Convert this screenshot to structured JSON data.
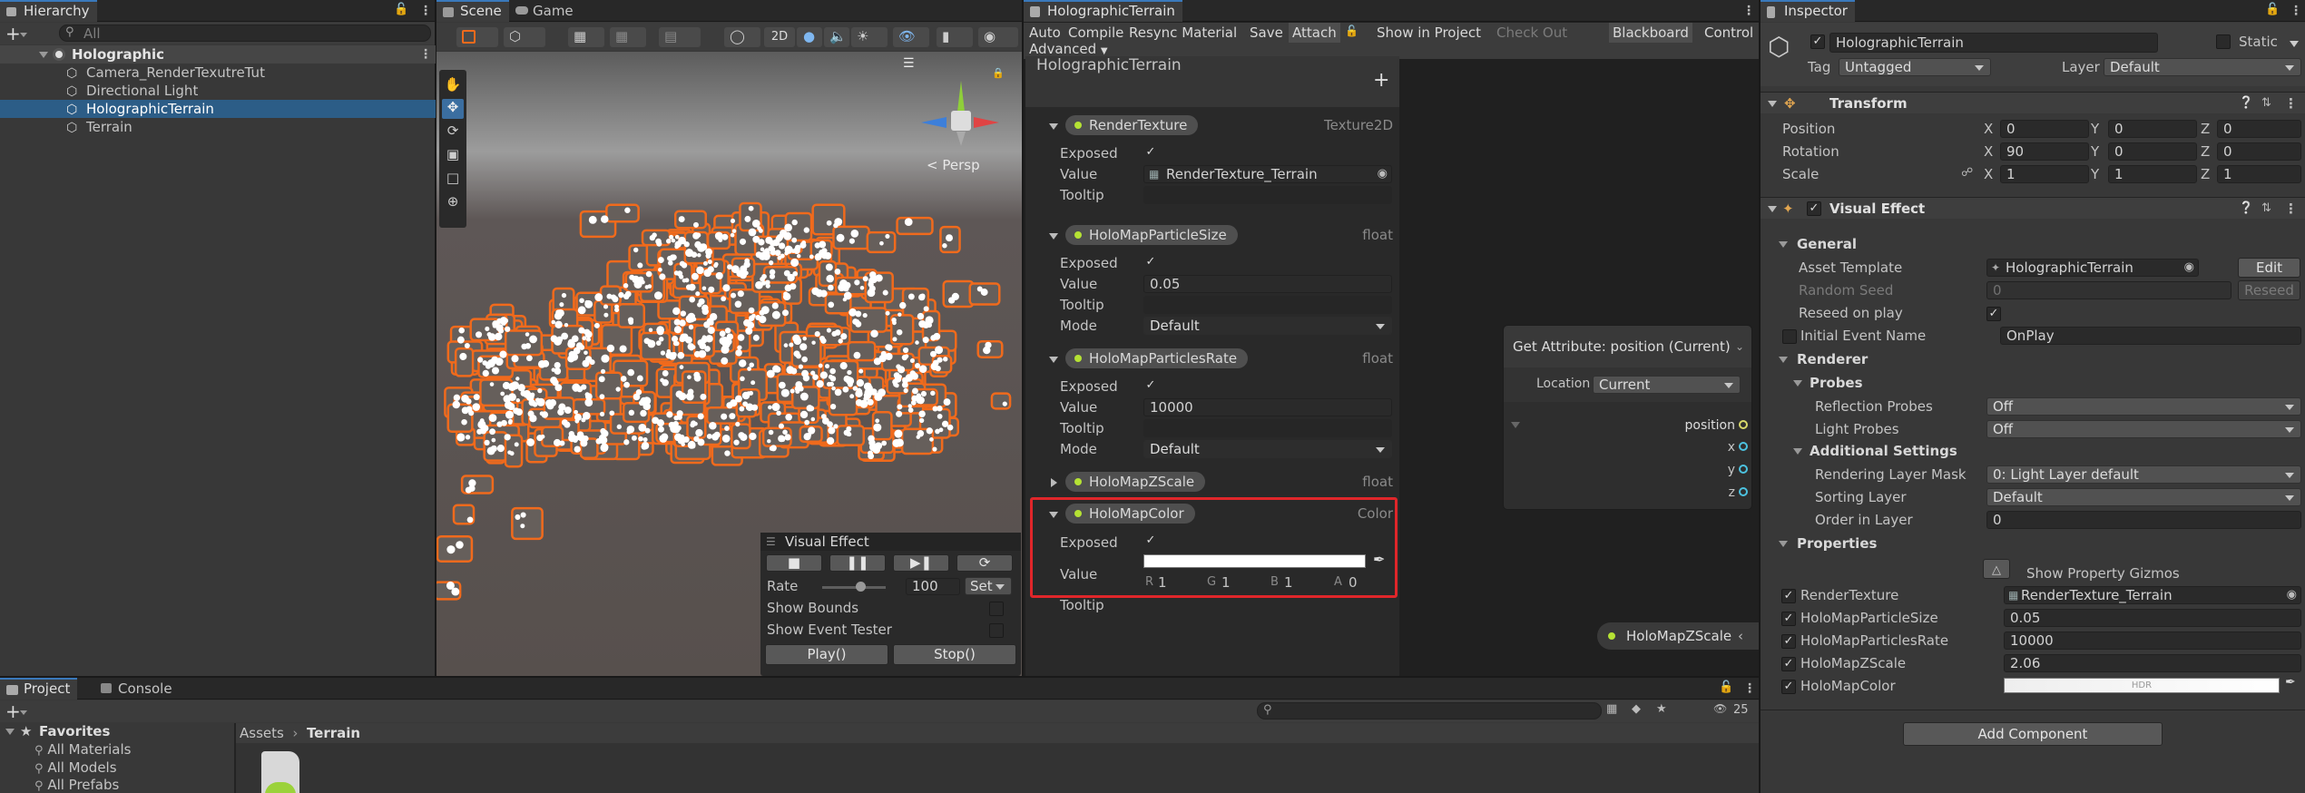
{
  "colors": {
    "accent": "#3a79bb",
    "selection": "#2c5d87",
    "outline": "#f06a1c",
    "red_box": "#e0262a",
    "exposed_dot": "#b5e234"
  },
  "hierarchy": {
    "tab": "Hierarchy",
    "search_placeholder": "All",
    "scene": "Holographic",
    "items": [
      "Camera_RenderTexutreTut",
      "Directional Light",
      "HolographicTerrain",
      "Terrain"
    ],
    "selected": "HolographicTerrain"
  },
  "scene_view": {
    "tab_scene": "Scene",
    "tab_game": "Game",
    "btn_2d": "2D",
    "persp": "Persp",
    "vfx_panel": {
      "title": "Visual Effect",
      "rate_label": "Rate",
      "rate_value": "100",
      "set_label": "Set",
      "rate_fraction": 0.6,
      "show_bounds": "Show Bounds",
      "show_event_tester": "Show Event Tester",
      "play": "Play()",
      "stop": "Stop()"
    }
  },
  "vfx_graph": {
    "tab": "HolographicTerrain",
    "toolbar": [
      "Auto",
      "Compile",
      "Resync Material",
      "Save",
      "Attach"
    ],
    "toolbar_right": [
      "Show in Project",
      "Check Out",
      "Blackboard",
      "Control"
    ],
    "advanced": "Advanced",
    "blackboard_title": "HolographicTerrain",
    "props": [
      {
        "name": "RenderTexture",
        "type": "Texture2D",
        "exposed_label": "Exposed",
        "value_label": "Value",
        "value": "RenderTexture_Terrain",
        "tooltip_label": "Tooltip"
      },
      {
        "name": "HoloMapParticleSize",
        "type": "float",
        "exposed_label": "Exposed",
        "value_label": "Value",
        "value": "0.05",
        "tooltip_label": "Tooltip",
        "mode_label": "Mode",
        "mode": "Default"
      },
      {
        "name": "HoloMapParticlesRate",
        "type": "float",
        "exposed_label": "Exposed",
        "value_label": "Value",
        "value": "10000",
        "tooltip_label": "Tooltip",
        "mode_label": "Mode",
        "mode": "Default"
      },
      {
        "name": "HoloMapZScale",
        "type": "float"
      },
      {
        "name": "HoloMapColor",
        "type": "Color",
        "exposed_label": "Exposed",
        "value_label": "Value",
        "tooltip_label": "Tooltip",
        "r_label": "R",
        "r": "1",
        "g_label": "G",
        "g": "1",
        "b_label": "B",
        "b": "1",
        "a_label": "A",
        "a": "0"
      }
    ],
    "node": {
      "title": "Get Attribute: position (Current)",
      "location_label": "Location",
      "location": "Current",
      "out": "position",
      "x": "x",
      "y": "y",
      "z": "z"
    },
    "zscale_node": "HoloMapZScale"
  },
  "inspector": {
    "tab": "Inspector",
    "object_name": "HolographicTerrain",
    "static_label": "Static",
    "tag_label": "Tag",
    "tag": "Untagged",
    "layer_label": "Layer",
    "layer": "Default",
    "transform": {
      "title": "Transform",
      "position_label": "Position",
      "rotation_label": "Rotation",
      "scale_label": "Scale",
      "x": "X",
      "y": "Y",
      "z": "Z",
      "position": [
        "0",
        "0",
        "0"
      ],
      "rotation": [
        "90",
        "0",
        "0"
      ],
      "scale": [
        "1",
        "1",
        "1"
      ]
    },
    "vfx": {
      "title": "Visual Effect",
      "general": "General",
      "asset_template_label": "Asset Template",
      "asset_template": "HolographicTerrain",
      "edit": "Edit",
      "random_seed_label": "Random Seed",
      "random_seed": "0",
      "reseed": "Reseed",
      "reseed_on_play": "Reseed on play",
      "initial_event_label": "Initial Event Name",
      "initial_event": "OnPlay",
      "renderer": "Renderer",
      "probes": "Probes",
      "reflection_probes_label": "Reflection Probes",
      "reflection_probes": "Off",
      "light_probes_label": "Light Probes",
      "light_probes": "Off",
      "additional": "Additional Settings",
      "rendering_layer_label": "Rendering Layer Mask",
      "rendering_layer": "0: Light Layer default",
      "sorting_layer_label": "Sorting Layer",
      "sorting_layer": "Default",
      "order_label": "Order in Layer",
      "order": "0",
      "properties": "Properties",
      "show_gizmos": "Show Property Gizmos",
      "props": [
        {
          "name": "RenderTexture",
          "value": "RenderTexture_Terrain"
        },
        {
          "name": "HoloMapParticleSize",
          "value": "0.05"
        },
        {
          "name": "HoloMapParticlesRate",
          "value": "10000"
        },
        {
          "name": "HoloMapZScale",
          "value": "2.06"
        },
        {
          "name": "HoloMapColor",
          "value": "HDR"
        }
      ]
    },
    "add_component": "Add Component"
  },
  "project": {
    "tab_project": "Project",
    "tab_console": "Console",
    "favorites": "Favorites",
    "fav_items": [
      "All Materials",
      "All Models",
      "All Prefabs"
    ],
    "breadcrumb_root": "Assets",
    "breadcrumb_leaf": "Terrain",
    "hidden_count": "25"
  }
}
